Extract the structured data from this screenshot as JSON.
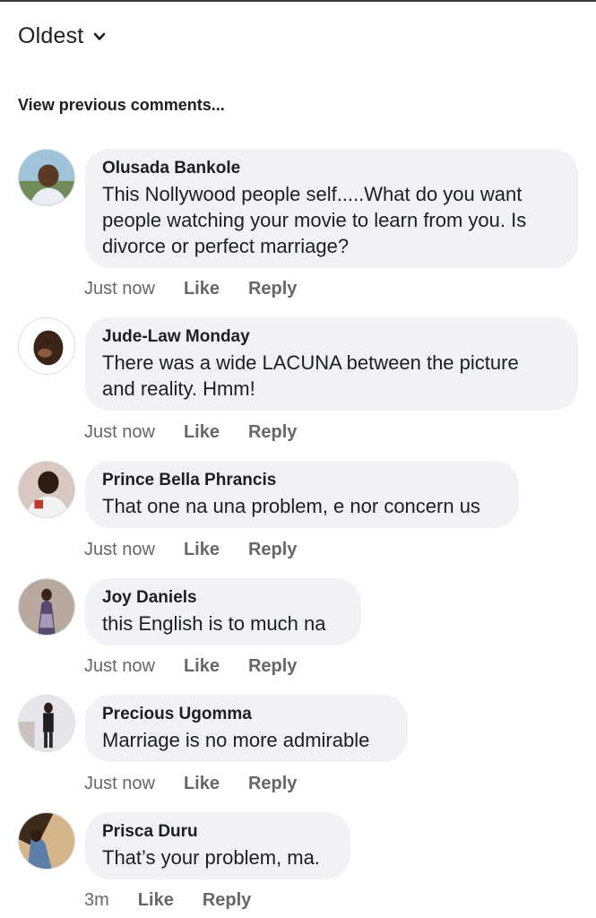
{
  "sort": {
    "label": "Oldest",
    "icon": "chevron-down-icon"
  },
  "view_previous": "View previous comments...",
  "comments": [
    {
      "author": "Olusada Bankole",
      "text_lines": [
        "This Nollywood people self.....What do you want",
        "people watching your movie to learn from you. Is",
        "divorce or perfect marriage?"
      ],
      "time": "Just now",
      "like": "Like",
      "reply": "Reply"
    },
    {
      "author": "Jude-Law Monday",
      "text_lines": [
        "There was a wide LACUNA between the picture",
        "and reality. Hmm!"
      ],
      "time": "Just now",
      "like": "Like",
      "reply": "Reply"
    },
    {
      "author": "Prince Bella Phrancis",
      "text_lines": [
        "That one na una problem, e nor concern us"
      ],
      "time": "Just now",
      "like": "Like",
      "reply": "Reply"
    },
    {
      "author": "Joy Daniels",
      "text_lines": [
        "this English is to much na"
      ],
      "time": "Just now",
      "like": "Like",
      "reply": "Reply"
    },
    {
      "author": "Precious Ugomma",
      "text_lines": [
        "Marriage is no more admirable"
      ],
      "time": "Just now",
      "like": "Like",
      "reply": "Reply"
    },
    {
      "author": "Prisca Duru",
      "text_lines": [
        "That’s your problem, ma."
      ],
      "time": "3m",
      "like": "Like",
      "reply": "Reply"
    }
  ],
  "colors": {
    "bubble": "#f0f2f5",
    "text": "#1c1e21",
    "meta": "#65676b"
  }
}
